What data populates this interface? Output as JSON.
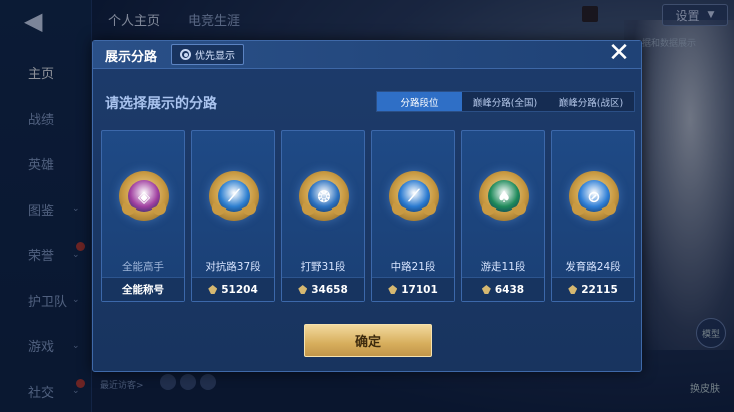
{
  "background": {
    "top_tabs": [
      "个人主页",
      "电竞生涯"
    ],
    "settings_label": "设置",
    "status_text": "",
    "tooltip_text": "据和数据展示",
    "nav_items": [
      {
        "label": "主页",
        "active": true,
        "chevron": false,
        "badge": false
      },
      {
        "label": "战绩",
        "active": false,
        "chevron": false,
        "badge": false
      },
      {
        "label": "英雄",
        "active": false,
        "chevron": false,
        "badge": false
      },
      {
        "label": "图鉴",
        "active": false,
        "chevron": true,
        "badge": false
      },
      {
        "label": "荣誉",
        "active": false,
        "chevron": true,
        "badge": true
      },
      {
        "label": "护卫队",
        "active": false,
        "chevron": true,
        "badge": false
      },
      {
        "label": "游戏",
        "active": false,
        "chevron": true,
        "badge": false
      },
      {
        "label": "社交",
        "active": false,
        "chevron": true,
        "badge": true
      }
    ],
    "bottom_text": "最近访客>",
    "model_label": "模型",
    "switch_label": "换皮肤"
  },
  "dialog": {
    "title": "展示分路",
    "priority_label": "优先显示",
    "close_symbol": "✕",
    "prompt": "请选择展示的分路",
    "segments": [
      {
        "label": "分路段位",
        "active": true
      },
      {
        "label": "巅峰分路(全国)",
        "active": false
      },
      {
        "label": "巅峰分路(战区)",
        "active": false
      }
    ],
    "cards": [
      {
        "name": "全能高手",
        "footer": "全能称号",
        "show_icon": false,
        "icon": "all-round-icon",
        "core_color": "#a03fa0",
        "glyph": "◈"
      },
      {
        "name": "对抗路37段",
        "footer": "51204",
        "show_icon": true,
        "icon": "clash-lane-icon",
        "core_color": "#2d7fd0",
        "glyph": "⟋"
      },
      {
        "name": "打野31段",
        "footer": "34658",
        "show_icon": true,
        "icon": "jungle-icon",
        "core_color": "#2d72c0",
        "glyph": "❂"
      },
      {
        "name": "中路21段",
        "footer": "17101",
        "show_icon": true,
        "icon": "mid-lane-icon",
        "core_color": "#2a7ad0",
        "glyph": "⟋"
      },
      {
        "name": "游走11段",
        "footer": "6438",
        "show_icon": true,
        "icon": "roam-icon",
        "core_color": "#1e8a5a",
        "glyph": "♠"
      },
      {
        "name": "发育路24段",
        "footer": "22115",
        "show_icon": true,
        "icon": "farm-lane-icon",
        "core_color": "#2f7fd6",
        "glyph": "⊘"
      }
    ],
    "confirm_label": "确定"
  }
}
